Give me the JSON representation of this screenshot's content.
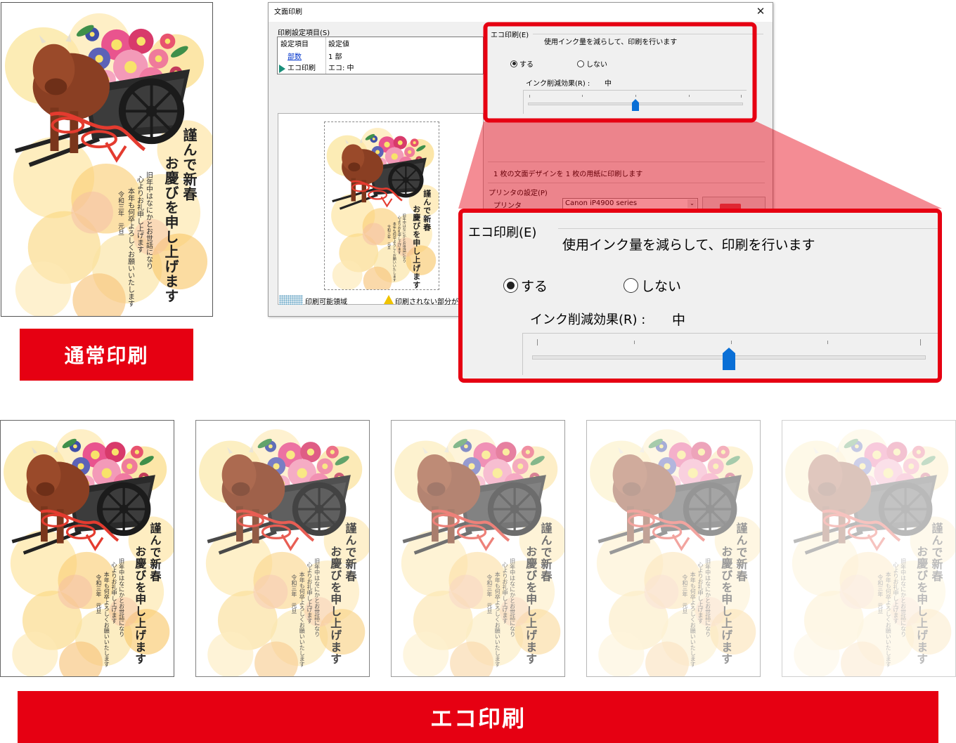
{
  "left_card": {
    "title_col1": "謹んで新春",
    "title_col2": "お慶びを申し上げます",
    "body_col1": "旧年中はなにかとお世話になり",
    "body_col2": "心よりお礼申し上げます",
    "body_col3": "本年も何卒よろしくお願いいたします",
    "date": "令和三年　元旦"
  },
  "labels": {
    "normal_print": "通常印刷",
    "eco_print": "エコ印刷"
  },
  "dialog": {
    "title": "文面印刷",
    "close_glyph": "✕",
    "settings_group_label": "印刷設定項目(S)",
    "list_header_item": "設定項目",
    "list_header_value": "設定値",
    "rows": [
      {
        "item": "部数",
        "value": "1 部"
      },
      {
        "item": "エコ印刷",
        "value": "エコ: 中"
      }
    ],
    "eco_group_label": "エコ印刷(E)",
    "eco_description": "使用インク量を減らして、印刷を行います",
    "option_on": "する",
    "option_off": "しない",
    "effect_label": "インク削減効果(R) :",
    "effect_value": "中",
    "info_text": "1 枚の文面デザインを 1 枚の用紙に印刷します",
    "printer_group_label": "プリンタの設定(P)",
    "printer_label": "プリンタ",
    "printer_value": "Canon iP4900 series",
    "legend_printable": "印刷可能領域",
    "legend_unprintable": "印刷されない部分が"
  },
  "zoom": {
    "eco_group_label": "エコ印刷(E)",
    "eco_description": "使用インク量を減らして、印刷を行います",
    "option_on": "する",
    "option_off": "しない",
    "effect_label": "インク削減効果(R) :",
    "effect_value": "中"
  },
  "colors": {
    "accent_red": "#e60012",
    "slider_blue": "#0a6fd6",
    "link_blue": "#0033cc"
  },
  "eco_levels": [
    1.0,
    0.82,
    0.64,
    0.46,
    0.3
  ],
  "slider": {
    "level": 0.5
  }
}
